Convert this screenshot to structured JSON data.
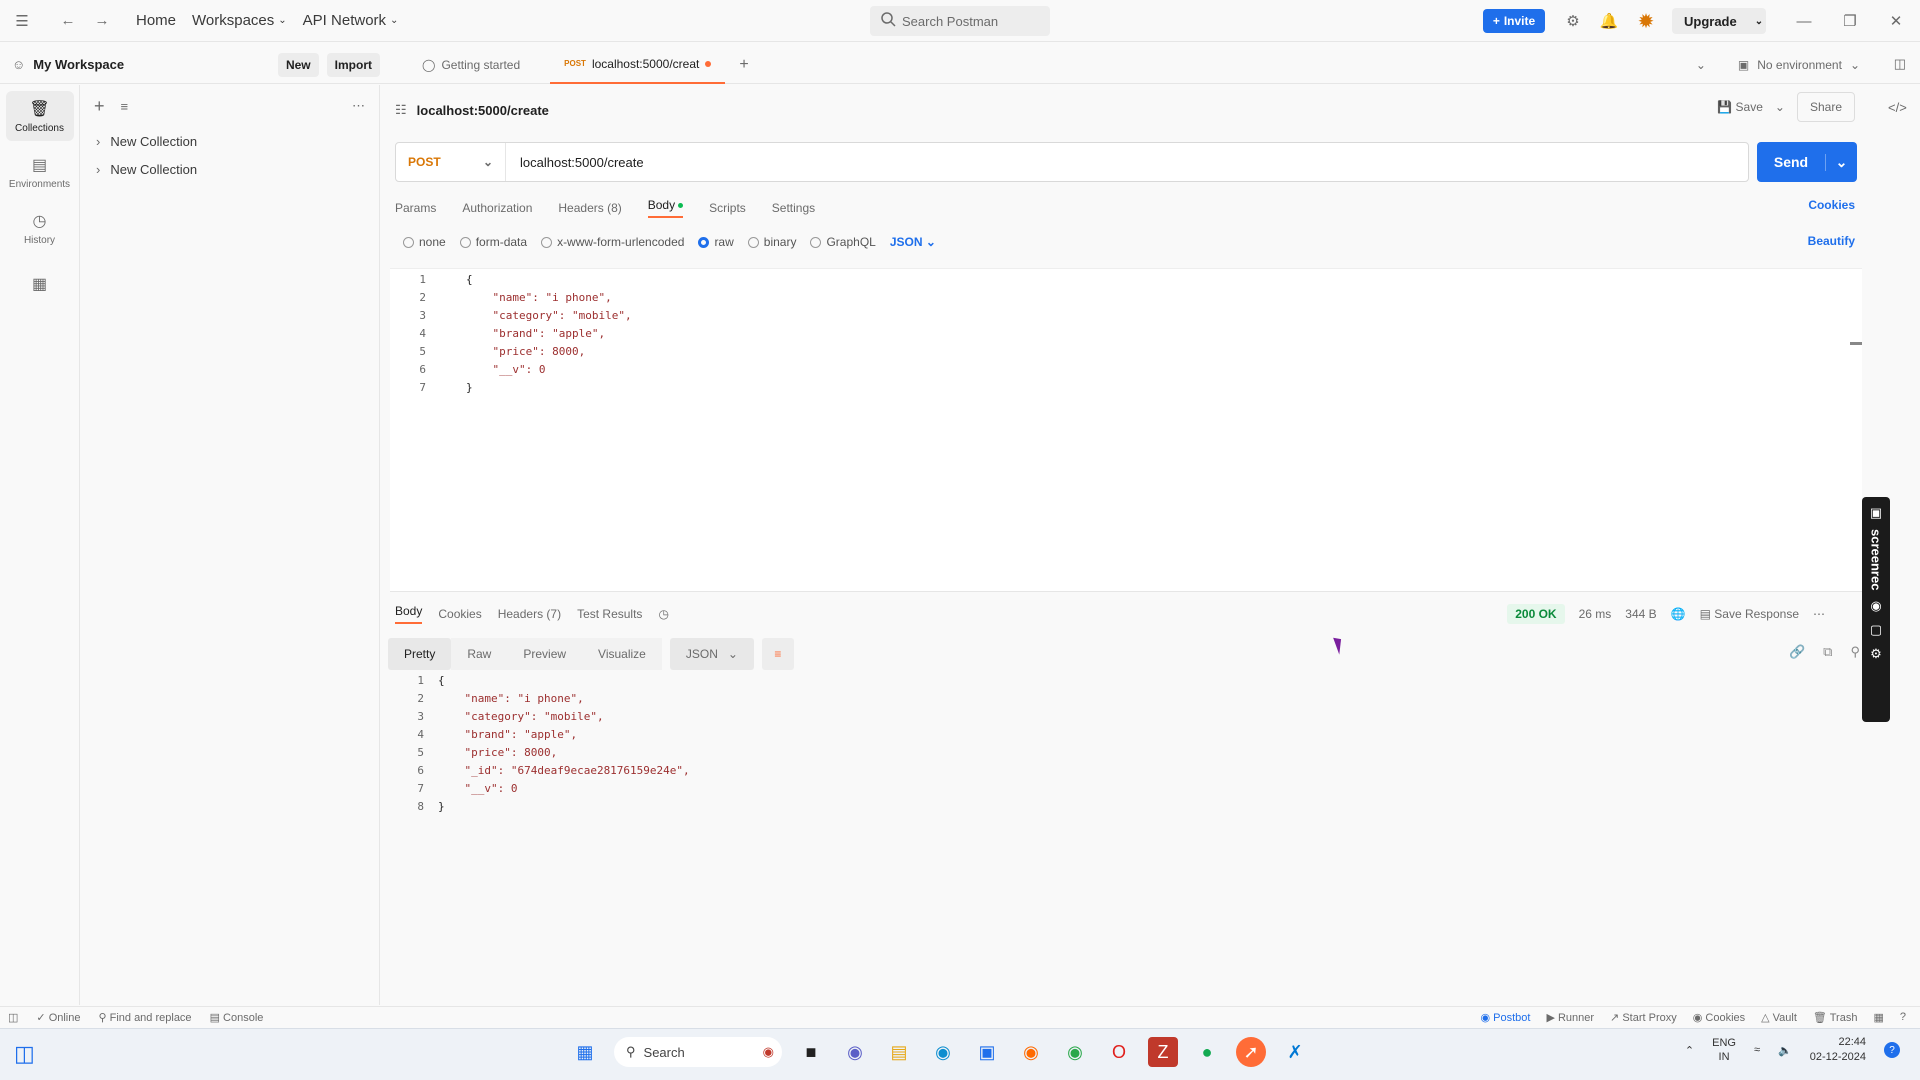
{
  "topbar": {
    "home": "Home",
    "workspaces": "Workspaces",
    "api_network": "API Network",
    "search_placeholder": "Search Postman",
    "invite": "Invite",
    "upgrade": "Upgrade"
  },
  "workspace": {
    "name": "My Workspace",
    "new": "New",
    "import": "Import"
  },
  "rail": [
    {
      "label": "Collections"
    },
    {
      "label": "Environments"
    },
    {
      "label": "History"
    }
  ],
  "collections": [
    {
      "label": "New Collection"
    },
    {
      "label": "New Collection"
    }
  ],
  "tabs": {
    "getting_started": "Getting started",
    "active_method": "POST",
    "active_label": "localhost:5000/creat",
    "environment": "No environment"
  },
  "request": {
    "title": "localhost:5000/create",
    "save": "Save",
    "share": "Share",
    "method": "POST",
    "url": "localhost:5000/create",
    "send": "Send",
    "tabs": {
      "params": "Params",
      "authorization": "Authorization",
      "headers": "Headers (8)",
      "body": "Body",
      "scripts": "Scripts",
      "settings": "Settings",
      "cookies": "Cookies"
    },
    "body_types": {
      "none": "none",
      "form_data": "form-data",
      "urlencoded": "x-www-form-urlencoded",
      "raw": "raw",
      "binary": "binary",
      "graphql": "GraphQL",
      "json": "JSON",
      "beautify": "Beautify"
    },
    "body_lines": [
      {
        "n": "1",
        "text": "{"
      },
      {
        "n": "2",
        "text": "    \"name\": \"i phone\","
      },
      {
        "n": "3",
        "text": "    \"category\": \"mobile\","
      },
      {
        "n": "4",
        "text": "    \"brand\": \"apple\","
      },
      {
        "n": "5",
        "text": "    \"price\": 8000,"
      },
      {
        "n": "6",
        "text": "    \"__v\": 0"
      },
      {
        "n": "7",
        "text": "}"
      }
    ]
  },
  "response": {
    "tabs": {
      "body": "Body",
      "cookies": "Cookies",
      "headers": "Headers (7)",
      "tests": "Test Results"
    },
    "status": "200 OK",
    "time": "26 ms",
    "size": "344 B",
    "save_response": "Save Response",
    "views": {
      "pretty": "Pretty",
      "raw": "Raw",
      "preview": "Preview",
      "visualize": "Visualize",
      "json": "JSON"
    },
    "body_lines": [
      {
        "n": "1",
        "text": "{"
      },
      {
        "n": "2",
        "text": "    \"name\": \"i phone\","
      },
      {
        "n": "3",
        "text": "    \"category\": \"mobile\","
      },
      {
        "n": "4",
        "text": "    \"brand\": \"apple\","
      },
      {
        "n": "5",
        "text": "    \"price\": 8000,"
      },
      {
        "n": "6",
        "text": "    \"_id\": \"674deaf9ecae28176159e24e\","
      },
      {
        "n": "7",
        "text": "    \"__v\": 0"
      },
      {
        "n": "8",
        "text": "}"
      }
    ]
  },
  "statusbar": {
    "online": "Online",
    "find_replace": "Find and replace",
    "console": "Console",
    "postbot": "Postbot",
    "runner": "Runner",
    "start_proxy": "Start Proxy",
    "cookies": "Cookies",
    "vault": "Vault",
    "trash": "Trash"
  },
  "taskbar": {
    "search": "Search",
    "lang1": "ENG",
    "lang2": "IN",
    "time": "22:44",
    "date": "02-12-2024"
  },
  "screenrec": {
    "label": "screenrec"
  }
}
